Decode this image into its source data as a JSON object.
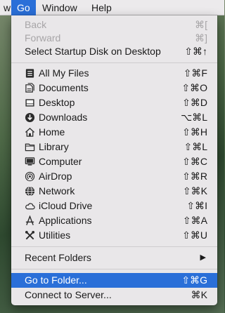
{
  "menubar": {
    "partial_item": "w",
    "go": "Go",
    "window": "Window",
    "help": "Help"
  },
  "menu": {
    "back": {
      "label": "Back",
      "shortcut": "⌘["
    },
    "forward": {
      "label": "Forward",
      "shortcut": "⌘]"
    },
    "startup": {
      "label": "Select Startup Disk on Desktop",
      "shortcut": "⇧⌘↑"
    },
    "places": [
      {
        "label": "All My Files",
        "shortcut": "⇧⌘F",
        "icon": "all-files-icon"
      },
      {
        "label": "Documents",
        "shortcut": "⇧⌘O",
        "icon": "documents-icon"
      },
      {
        "label": "Desktop",
        "shortcut": "⇧⌘D",
        "icon": "desktop-icon"
      },
      {
        "label": "Downloads",
        "shortcut": "⌥⌘L",
        "icon": "downloads-icon"
      },
      {
        "label": "Home",
        "shortcut": "⇧⌘H",
        "icon": "home-icon"
      },
      {
        "label": "Library",
        "shortcut": "⇧⌘L",
        "icon": "folder-icon"
      },
      {
        "label": "Computer",
        "shortcut": "⇧⌘C",
        "icon": "computer-icon"
      },
      {
        "label": "AirDrop",
        "shortcut": "⇧⌘R",
        "icon": "airdrop-icon"
      },
      {
        "label": "Network",
        "shortcut": "⇧⌘K",
        "icon": "network-icon"
      },
      {
        "label": "iCloud Drive",
        "shortcut": "⇧⌘I",
        "icon": "icloud-icon"
      },
      {
        "label": "Applications",
        "shortcut": "⇧⌘A",
        "icon": "applications-icon"
      },
      {
        "label": "Utilities",
        "shortcut": "⇧⌘U",
        "icon": "utilities-icon"
      }
    ],
    "recent": {
      "label": "Recent Folders",
      "arrow": "▶"
    },
    "goto": {
      "label": "Go to Folder...",
      "shortcut": "⇧⌘G"
    },
    "connect": {
      "label": "Connect to Server...",
      "shortcut": "⌘K"
    }
  }
}
